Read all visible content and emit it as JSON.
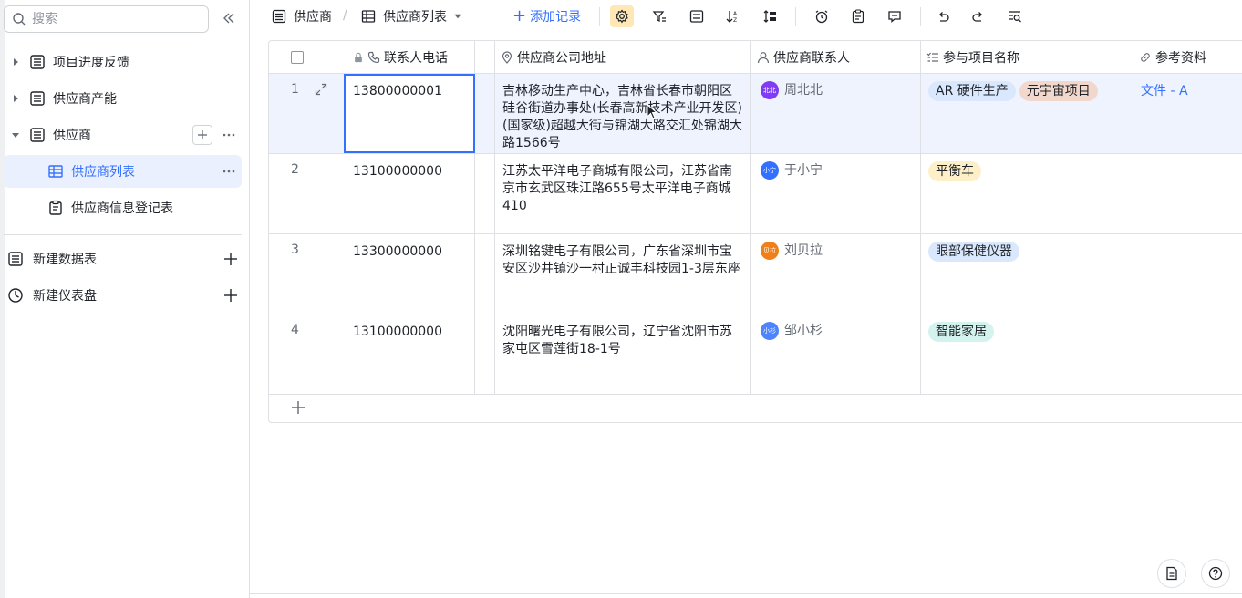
{
  "sidebar": {
    "search_placeholder": "搜索",
    "items": [
      {
        "label": "项目进度反馈"
      },
      {
        "label": "供应商产能"
      },
      {
        "label": "供应商"
      },
      {
        "label": "供应商列表"
      },
      {
        "label": "供应商信息登记表"
      }
    ],
    "new_table_label": "新建数据表",
    "new_dashboard_label": "新建仪表盘"
  },
  "topbar": {
    "base_name": "供应商",
    "view_name": "供应商列表",
    "add_record_label": "添加记录"
  },
  "grid": {
    "columns": [
      {
        "label": "联系人电话"
      },
      {
        "label": "供应商公司地址"
      },
      {
        "label": "供应商联系人"
      },
      {
        "label": "参与项目名称"
      },
      {
        "label": "参考资料"
      }
    ],
    "rows": [
      {
        "num": "1",
        "phone": "13800000001",
        "address": "吉林移动生产中心，吉林省长春市朝阳区硅谷街道办事处(长春高新技术产业开发区)(国家级)超越大街与锦湖大路交汇处锦湖大路1566号",
        "contact": "周北北",
        "avatar": "北北",
        "avatar_color": "#7f3bf5",
        "tags": [
          {
            "text": "AR 硬件生产",
            "color": "#d9e8fc"
          },
          {
            "text": "元宇宙项目",
            "color": "#f2d8cc"
          }
        ],
        "ref": "文件 - A"
      },
      {
        "num": "2",
        "phone": "13100000000",
        "address": "江苏太平洋电子商城有限公司，江苏省南京市玄武区珠江路655号太平洋电子商城410",
        "contact": "于小宁",
        "avatar": "小宁",
        "avatar_color": "#3370ff",
        "tags": [
          {
            "text": "平衡车",
            "color": "#fdf0c8"
          }
        ],
        "ref": ""
      },
      {
        "num": "3",
        "phone": "13300000000",
        "address": "深圳铭键电子有限公司，广东省深圳市宝安区沙井镇沙一村正诚丰科技园1-3层东座",
        "contact": "刘贝拉",
        "avatar": "贝拉",
        "avatar_color": "#f07f17",
        "tags": [
          {
            "text": "眼部保健仪器",
            "color": "#d9e8fc"
          }
        ],
        "ref": ""
      },
      {
        "num": "4",
        "phone": "13100000000",
        "address": "沈阳曙光电子有限公司，辽宁省沈阳市苏家屯区雪莲街18-1号",
        "contact": "邹小杉",
        "avatar": "小杉",
        "avatar_color": "#4e83fd",
        "tags": [
          {
            "text": "智能家居",
            "color": "#d4f3ee"
          }
        ],
        "ref": ""
      }
    ]
  },
  "colors": {
    "accent": "#3370ff",
    "selected_row": "#eef3fe",
    "toolbar_active": "#ffe8b6"
  }
}
